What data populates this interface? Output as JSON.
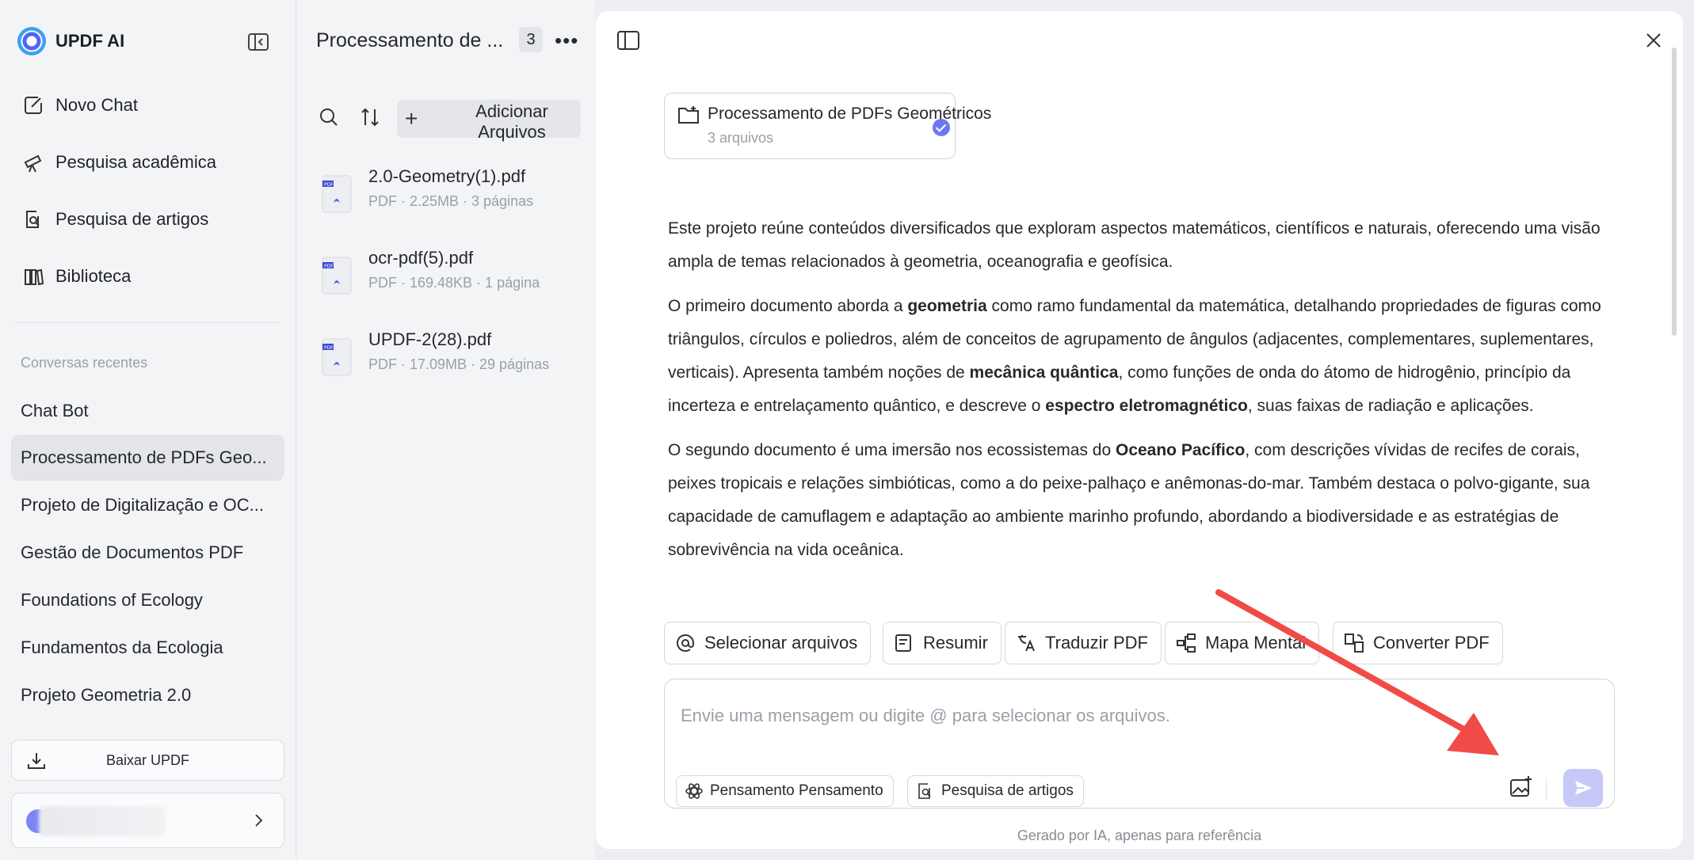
{
  "sidebar": {
    "logo_text": "UPDF AI",
    "nav": [
      {
        "label": "Novo Chat",
        "icon": "edit-icon"
      },
      {
        "label": "Pesquisa acadêmica",
        "icon": "telescope-icon"
      },
      {
        "label": "Pesquisa de artigos",
        "icon": "doc-search-icon"
      },
      {
        "label": "Biblioteca",
        "icon": "library-icon"
      }
    ],
    "recent_label": "Conversas recentes",
    "conversations": [
      "Chat Bot",
      "Processamento de PDFs Geo...",
      "Projeto de Digitalização e OC...",
      "Gestão de Documentos PDF",
      "Foundations of Ecology",
      "Fundamentos da Ecologia",
      "Projeto Geometria 2.0"
    ],
    "download_label": "Baixar UPDF"
  },
  "file_panel": {
    "title": "Processamento de ...",
    "count": "3",
    "add_label": "Adicionar Arquivos",
    "files": [
      {
        "name": "2.0-Geometry(1).pdf",
        "meta": "PDF · 2.25MB · 3 páginas"
      },
      {
        "name": "ocr-pdf(5).pdf",
        "meta": "PDF · 169.48KB · 1 página"
      },
      {
        "name": "UPDF-2(28).pdf",
        "meta": "PDF · 17.09MB · 29 páginas"
      }
    ]
  },
  "main": {
    "project_title": "Processamento de PDFs Geométricos",
    "project_sub": "3 arquivos",
    "p1": "Este projeto reúne conteúdos diversificados que exploram aspectos matemáticos, científicos e naturais, oferecendo uma visão ampla de temas relacionados à geometria, oceanografia e geofísica.",
    "p2_a": "O primeiro documento aborda a ",
    "p2_b": "geometria",
    "p2_c": " como ramo fundamental da matemática, detalhando propriedades de figuras como triângulos, círculos e poliedros, além de conceitos de agrupamento de ângulos (adjacentes, complementares, suplementares, verticais). Apresenta também noções de ",
    "p2_d": "mecânica quântica",
    "p2_e": ", como funções de onda do átomo de hidrogênio, princípio da incerteza e entrelaçamento quântico, e descreve o ",
    "p2_f": "espectro eletromagnético",
    "p2_g": ", suas faixas de radiação e aplicações.",
    "p3_a": "O segundo documento é uma imersão nos ecossistemas do ",
    "p3_b": "Oceano Pacífico",
    "p3_c": ", com descrições vívidas de recifes de corais, peixes tropicais e relações simbióticas, como a do peixe-palhaço e anêmonas-do-mar. Também destaca o polvo-gigante, sua capacidade de camuflagem e adaptação ao ambiente marinho profundo, abordando a biodiversidade e as estratégias de sobrevivência na vida oceânica.",
    "actions": [
      "Selecionar arquivos",
      "Resumir",
      "Traduzir PDF",
      "Mapa Mental",
      "Converter PDF"
    ],
    "input_placeholder": "Envie uma mensagem ou digite @ para selecionar os arquivos.",
    "pill_think": "Pensamento Pensamento",
    "pill_search": "Pesquisa de artigos",
    "footer": "Gerado por IA, apenas para referência"
  },
  "colors": {
    "accent": "#6d78f0",
    "annotation_arrow": "#f04b46"
  }
}
